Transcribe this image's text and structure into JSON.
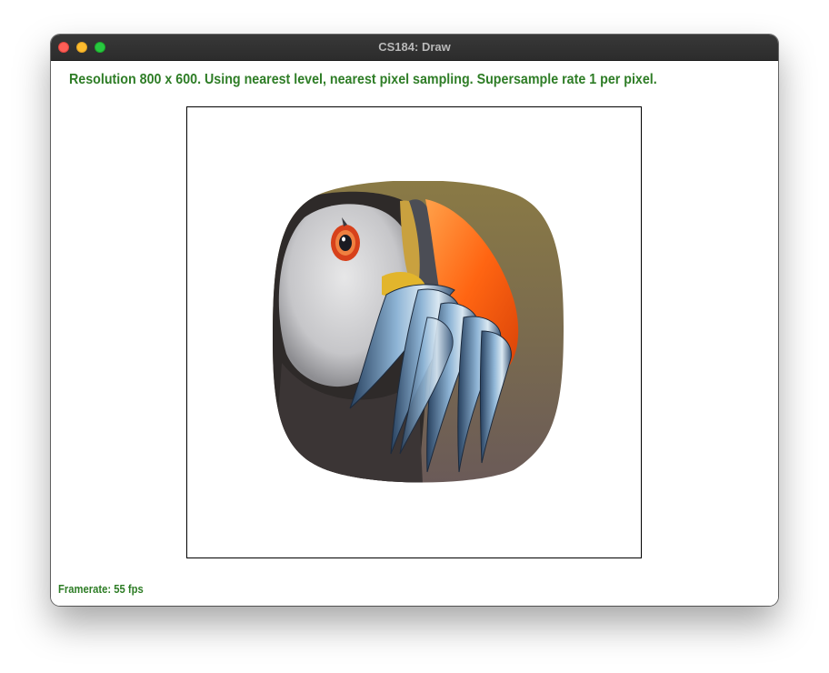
{
  "window": {
    "title": "CS184: Draw",
    "controls": {
      "close": "close",
      "minimize": "minimize",
      "zoom": "zoom"
    }
  },
  "overlay": {
    "status": "Resolution 800 x 600. Using nearest level, nearest pixel sampling. Supersample rate 1 per pixel.",
    "framerate": "Framerate: 55 fps"
  },
  "colors": {
    "overlay_text": "#2e7d26",
    "title_bar": "#2c2c2c",
    "close": "#fe5f57",
    "minimize": "#febc2e",
    "zoom": "#28c840"
  },
  "render": {
    "subject": "puffin with fish",
    "icon": "textured-warped-image"
  }
}
